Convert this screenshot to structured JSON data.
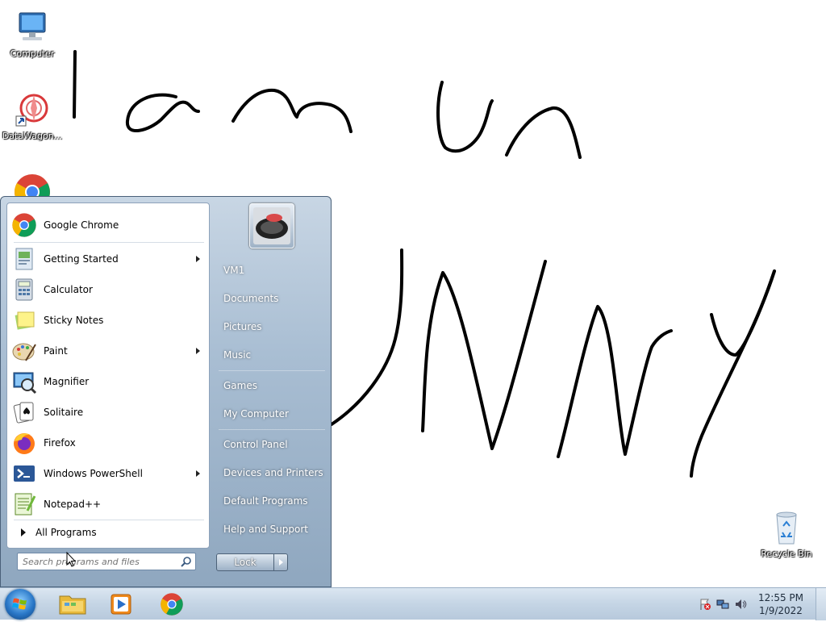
{
  "desktop": {
    "icons": [
      {
        "label": "Computer",
        "icon": "computer-icon"
      },
      {
        "label": "DataWagon...",
        "icon": "datawagon-shortcut-icon"
      },
      {
        "label": "Google Chrome",
        "icon": "chrome-icon"
      },
      {
        "label": "Recycle Bin",
        "icon": "recycle-bin-icon"
      }
    ],
    "drawing_words": [
      "I am Un",
      "UNNY"
    ]
  },
  "start_menu": {
    "programs": [
      {
        "label": "Google Chrome",
        "icon": "chrome-icon",
        "submenu": false
      },
      {
        "label": "Getting Started",
        "icon": "getting-started-icon",
        "submenu": true
      },
      {
        "label": "Calculator",
        "icon": "calculator-icon",
        "submenu": false
      },
      {
        "label": "Sticky Notes",
        "icon": "sticky-notes-icon",
        "submenu": false
      },
      {
        "label": "Paint",
        "icon": "paint-icon",
        "submenu": true
      },
      {
        "label": "Magnifier",
        "icon": "magnifier-icon",
        "submenu": false
      },
      {
        "label": "Solitaire",
        "icon": "solitaire-icon",
        "submenu": false
      },
      {
        "label": "Firefox",
        "icon": "firefox-icon",
        "submenu": false
      },
      {
        "label": "Windows PowerShell",
        "icon": "powershell-icon",
        "submenu": true
      },
      {
        "label": "Notepad++",
        "icon": "notepadpp-icon",
        "submenu": false
      }
    ],
    "all_programs": "All Programs",
    "search_placeholder": "Search programs and files",
    "right_items": [
      {
        "label": "VM1"
      },
      {
        "label": "Documents"
      },
      {
        "label": "Pictures"
      },
      {
        "label": "Music"
      },
      {
        "label": "Games"
      },
      {
        "label": "My Computer"
      },
      {
        "label": "Control Panel"
      },
      {
        "label": "Devices and Printers"
      },
      {
        "label": "Default Programs"
      },
      {
        "label": "Help and Support"
      }
    ],
    "lock_label": "Lock"
  },
  "taskbar": {
    "pinned": [
      {
        "name": "Windows Explorer",
        "icon": "explorer-folder-icon"
      },
      {
        "name": "Windows Media Player",
        "icon": "media-player-icon"
      },
      {
        "name": "Google Chrome",
        "icon": "chrome-icon"
      }
    ],
    "time": "12:55 PM",
    "date": "1/9/2022"
  },
  "colors": {
    "menu_frame": "#a9bed3",
    "taskbar": "#c5d5e5",
    "ink": "#000000"
  }
}
